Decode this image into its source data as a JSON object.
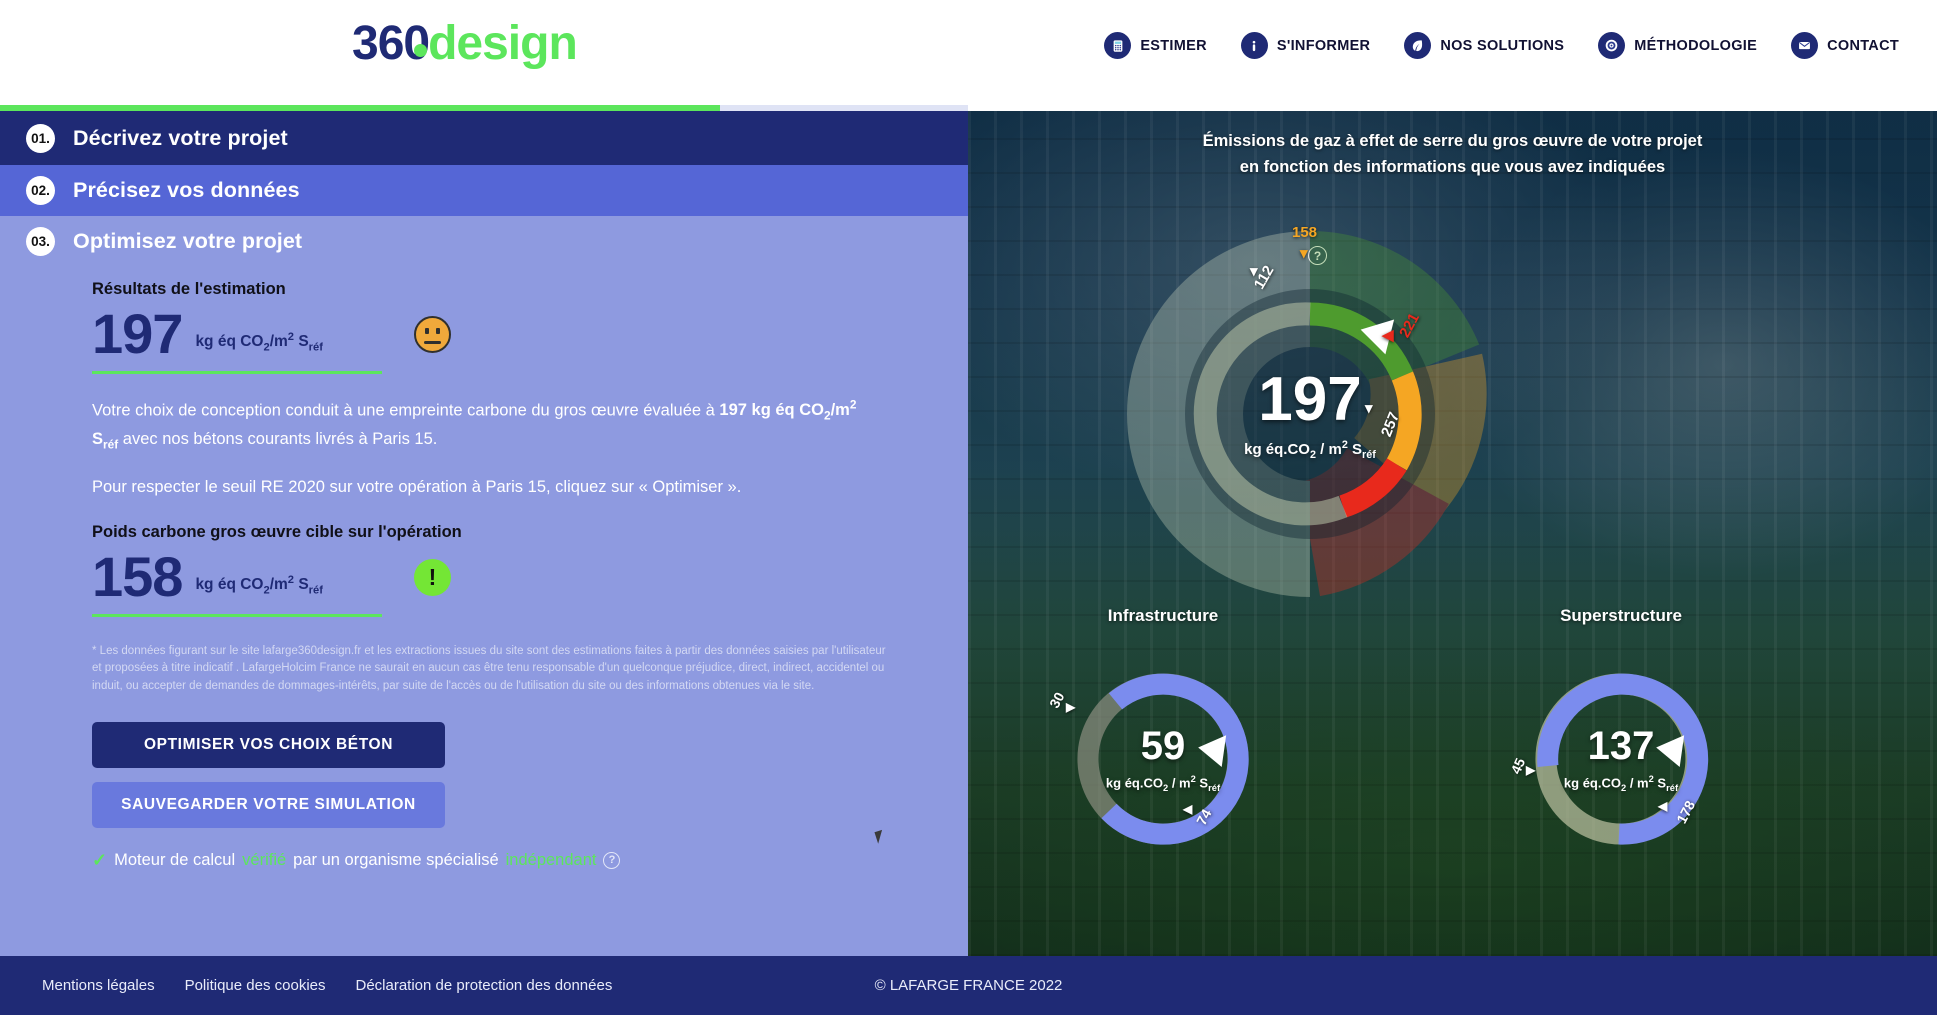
{
  "header": {
    "logo": {
      "primary": "360",
      "secondary": "design"
    },
    "nav": [
      {
        "label": "ESTIMER",
        "icon": "calculator-icon"
      },
      {
        "label": "S'INFORMER",
        "icon": "info-icon"
      },
      {
        "label": "NOS SOLUTIONS",
        "icon": "leaf-icon"
      },
      {
        "label": "MÉTHODOLOGIE",
        "icon": "target-icon"
      },
      {
        "label": "CONTACT",
        "icon": "envelope-icon"
      }
    ]
  },
  "steps": [
    {
      "number": "01.",
      "title": "Décrivez votre projet"
    },
    {
      "number": "02.",
      "title": "Précisez vos données"
    },
    {
      "number": "03.",
      "title": "Optimisez votre projet"
    }
  ],
  "results": {
    "section_title": "Résultats de l'estimation",
    "value": "197",
    "unit_kg": "kg éq CO",
    "unit_sub": "2",
    "unit_mid": "/m",
    "unit_sup": "2",
    "unit_s": " S",
    "unit_ref": "réf",
    "status_icon": "neutral-face-icon",
    "paragraph1_a": "Votre choix de conception conduit à une empreinte carbone du gros œuvre évaluée à ",
    "paragraph1_bold": "197 kg éq CO₂/m² Sréf",
    "paragraph1_b": " avec nos bétons courants livrés à Paris 15.",
    "paragraph2": "Pour respecter le seuil RE 2020 sur votre opération à Paris 15, cliquez sur « Optimiser »."
  },
  "target": {
    "section_title": "Poids carbone gros œuvre cible sur l'opération",
    "value": "158",
    "status_icon": "warning-icon",
    "status_glyph": "!"
  },
  "disclaimer": "* Les données figurant sur le site lafarge360design.fr et les extractions issues du site sont des estimations faites à partir des données saisies par l'utilisateur et proposées à titre indicatif . LafargeHolcim France ne saurait en aucun cas être tenu responsable d'un quelconque préjudice, direct, indirect, accidentel ou induit, ou accepter de demandes de dommages-intérêts, par suite de l'accès ou de l'utilisation du site ou des informations obtenues via le site.",
  "buttons": {
    "optimize": "OPTIMISER VOS CHOIX BÉTON",
    "save": "SAUVEGARDER VOTRE SIMULATION"
  },
  "verified": {
    "check": "✓",
    "part1": "Moteur de calcul ",
    "green1": "vérifié",
    "part2": " par un organisme spécialisé ",
    "green2": "indépendant",
    "help": "?"
  },
  "right_panel": {
    "title_line1": "Émissions de gaz à effet de serre du gros œuvre de votre projet",
    "title_line2": "en fonction des informations que vous avez indiquées",
    "help": "?"
  },
  "chart_data": [
    {
      "type": "gauge",
      "name": "main-gauge",
      "title": "Émissions de gaz à effet de serre du gros œuvre de votre projet en fonction des informations que vous avez indiquées",
      "value": 197,
      "unit": "kg éq.CO2 / m² Sréf",
      "min": 112,
      "max": 257,
      "ticks": [
        {
          "label": "112",
          "value": 112,
          "color": "#ffffff"
        },
        {
          "label": "158",
          "value": 158,
          "color": "#f5a623"
        },
        {
          "label": "221",
          "value": 221,
          "color": "#e8291c"
        },
        {
          "label": "257",
          "value": 257,
          "color": "#ffffff"
        }
      ],
      "segments": [
        {
          "from": 112,
          "to": 158,
          "color": "#4e9b2e",
          "name": "green"
        },
        {
          "from": 158,
          "to": 221,
          "color": "#f5a623",
          "name": "orange"
        },
        {
          "from": 221,
          "to": 257,
          "color": "#e8291c",
          "name": "red"
        }
      ],
      "marker": {
        "value": 197,
        "color": "#ffffff"
      }
    },
    {
      "type": "gauge",
      "name": "infrastructure-gauge",
      "title": "Infrastructure",
      "value": 59,
      "unit": "kg éq.CO2 / m² Sréf",
      "min": 30,
      "max": 74,
      "ticks": [
        {
          "label": "30",
          "value": 30,
          "color": "#ffffff"
        },
        {
          "label": "74",
          "value": 74,
          "color": "#ffffff"
        }
      ],
      "segments": [
        {
          "from": 30,
          "to": 74,
          "color": "#7b8cee",
          "name": "range"
        }
      ],
      "marker": {
        "value": 59,
        "color": "#ffffff"
      }
    },
    {
      "type": "gauge",
      "name": "superstructure-gauge",
      "title": "Superstructure",
      "value": 137,
      "unit": "kg éq.CO2 / m² Sréf",
      "min": 45,
      "max": 178,
      "ticks": [
        {
          "label": "45",
          "value": 45,
          "color": "#ffffff"
        },
        {
          "label": "178",
          "value": 178,
          "color": "#ffffff"
        }
      ],
      "segments": [
        {
          "from": 45,
          "to": 178,
          "color": "#7b8cee",
          "name": "range"
        }
      ],
      "marker": {
        "value": 137,
        "color": "#ffffff"
      }
    }
  ],
  "gauges": {
    "main": {
      "value": "197",
      "min": "112",
      "mid": "158",
      "high": "221",
      "max": "257"
    },
    "infrastructure": {
      "label": "Infrastructure",
      "value": "59",
      "min": "30",
      "max": "74"
    },
    "superstructure": {
      "label": "Superstructure",
      "value": "137",
      "min": "45",
      "max": "178"
    }
  },
  "footer": {
    "links": [
      "Mentions légales",
      "Politique des cookies",
      "Déclaration de protection des données"
    ],
    "copyright": "© LAFARGE FRANCE 2022"
  }
}
